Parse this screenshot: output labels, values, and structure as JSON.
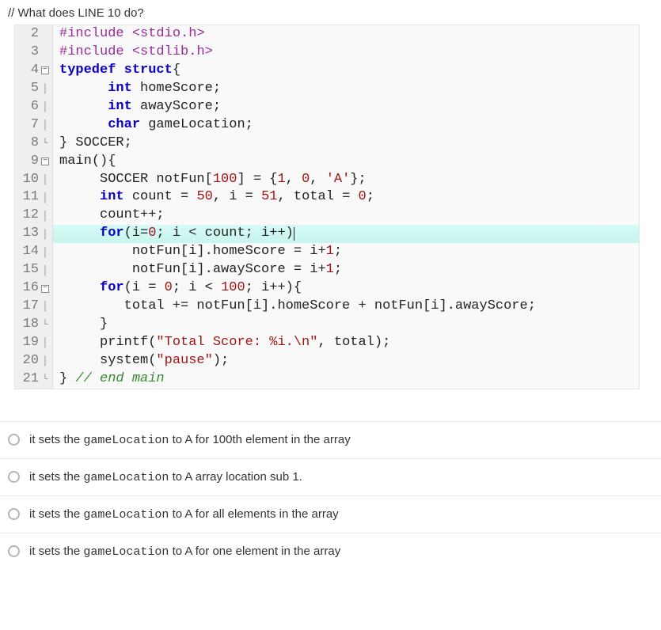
{
  "question": "// What does LINE 10 do?",
  "code": {
    "lines": [
      {
        "n": "2",
        "fold": "",
        "seg": [
          {
            "c": "pre",
            "t": "#include "
          },
          {
            "c": "pre",
            "t": "<stdio.h>"
          }
        ]
      },
      {
        "n": "3",
        "fold": "",
        "seg": [
          {
            "c": "pre",
            "t": "#include "
          },
          {
            "c": "pre",
            "t": "<stdlib.h>"
          }
        ]
      },
      {
        "n": "4",
        "fold": "minus",
        "seg": [
          {
            "c": "kw",
            "t": "typedef struct"
          },
          {
            "c": "norm",
            "t": "{"
          }
        ]
      },
      {
        "n": "5",
        "fold": "bar",
        "seg": [
          {
            "c": "norm",
            "t": "      "
          },
          {
            "c": "kw",
            "t": "int"
          },
          {
            "c": "norm",
            "t": " homeScore;"
          }
        ]
      },
      {
        "n": "6",
        "fold": "bar",
        "seg": [
          {
            "c": "norm",
            "t": "      "
          },
          {
            "c": "kw",
            "t": "int"
          },
          {
            "c": "norm",
            "t": " awayScore;"
          }
        ]
      },
      {
        "n": "7",
        "fold": "bar",
        "seg": [
          {
            "c": "norm",
            "t": "      "
          },
          {
            "c": "kw",
            "t": "char"
          },
          {
            "c": "norm",
            "t": " gameLocation;"
          }
        ]
      },
      {
        "n": "8",
        "fold": "end",
        "seg": [
          {
            "c": "norm",
            "t": "} SOCCER;"
          }
        ]
      },
      {
        "n": "9",
        "fold": "minus",
        "seg": [
          {
            "c": "fn",
            "t": "main"
          },
          {
            "c": "norm",
            "t": "(){"
          }
        ]
      },
      {
        "n": "10",
        "fold": "bar",
        "seg": [
          {
            "c": "norm",
            "t": "     SOCCER notFun["
          },
          {
            "c": "num",
            "t": "100"
          },
          {
            "c": "norm",
            "t": "] = {"
          },
          {
            "c": "num",
            "t": "1"
          },
          {
            "c": "norm",
            "t": ", "
          },
          {
            "c": "num",
            "t": "0"
          },
          {
            "c": "norm",
            "t": ", "
          },
          {
            "c": "chr",
            "t": "'A'"
          },
          {
            "c": "norm",
            "t": "};"
          }
        ]
      },
      {
        "n": "11",
        "fold": "bar",
        "seg": [
          {
            "c": "norm",
            "t": "     "
          },
          {
            "c": "kw",
            "t": "int"
          },
          {
            "c": "norm",
            "t": " count = "
          },
          {
            "c": "num",
            "t": "50"
          },
          {
            "c": "norm",
            "t": ", i = "
          },
          {
            "c": "num",
            "t": "51"
          },
          {
            "c": "norm",
            "t": ", total = "
          },
          {
            "c": "num",
            "t": "0"
          },
          {
            "c": "norm",
            "t": ";"
          }
        ]
      },
      {
        "n": "12",
        "fold": "bar",
        "seg": [
          {
            "c": "norm",
            "t": "     count++;"
          }
        ]
      },
      {
        "n": "13",
        "fold": "bar",
        "hl": true,
        "caretAfter": 5,
        "seg": [
          {
            "c": "norm",
            "t": "     "
          },
          {
            "c": "kw",
            "t": "for"
          },
          {
            "c": "norm",
            "t": "(i="
          },
          {
            "c": "num",
            "t": "0"
          },
          {
            "c": "norm",
            "t": "; i < count"
          },
          {
            "c": "norm",
            "t": "; i++)"
          }
        ]
      },
      {
        "n": "14",
        "fold": "bar",
        "seg": [
          {
            "c": "norm",
            "t": "         notFun[i].homeScore = i+"
          },
          {
            "c": "num",
            "t": "1"
          },
          {
            "c": "norm",
            "t": ";"
          }
        ]
      },
      {
        "n": "15",
        "fold": "bar",
        "seg": [
          {
            "c": "norm",
            "t": "         notFun[i].awayScore = i+"
          },
          {
            "c": "num",
            "t": "1"
          },
          {
            "c": "norm",
            "t": ";"
          }
        ]
      },
      {
        "n": "16",
        "fold": "minus",
        "seg": [
          {
            "c": "norm",
            "t": "     "
          },
          {
            "c": "kw",
            "t": "for"
          },
          {
            "c": "norm",
            "t": "(i = "
          },
          {
            "c": "num",
            "t": "0"
          },
          {
            "c": "norm",
            "t": "; i < "
          },
          {
            "c": "num",
            "t": "100"
          },
          {
            "c": "norm",
            "t": "; i++){"
          }
        ]
      },
      {
        "n": "17",
        "fold": "bar",
        "seg": [
          {
            "c": "norm",
            "t": "        total += notFun[i].homeScore + notFun[i].awayScore;"
          }
        ]
      },
      {
        "n": "18",
        "fold": "end",
        "seg": [
          {
            "c": "norm",
            "t": "     }"
          }
        ]
      },
      {
        "n": "19",
        "fold": "bar",
        "seg": [
          {
            "c": "norm",
            "t": "     printf("
          },
          {
            "c": "str",
            "t": "\"Total Score: %i.\\n\""
          },
          {
            "c": "norm",
            "t": ", total);"
          }
        ]
      },
      {
        "n": "20",
        "fold": "bar",
        "seg": [
          {
            "c": "norm",
            "t": "     system("
          },
          {
            "c": "str",
            "t": "\"pause\""
          },
          {
            "c": "norm",
            "t": ");"
          }
        ]
      },
      {
        "n": "21",
        "fold": "end",
        "seg": [
          {
            "c": "norm",
            "t": "} "
          },
          {
            "c": "cmt",
            "t": "// end main"
          }
        ]
      }
    ]
  },
  "options": [
    {
      "pre": "it sets the ",
      "mono": "gameLocation",
      "post": " to A for 100th element in the array"
    },
    {
      "pre": "it sets the ",
      "mono": "gameLocation",
      "post": " to A array location sub 1."
    },
    {
      "pre": "it sets the ",
      "mono": "gameLocation",
      "post": " to A for all elements in the array"
    },
    {
      "pre": "it sets the ",
      "mono": "gameLocation",
      "post": " to A for one element in the array"
    }
  ]
}
